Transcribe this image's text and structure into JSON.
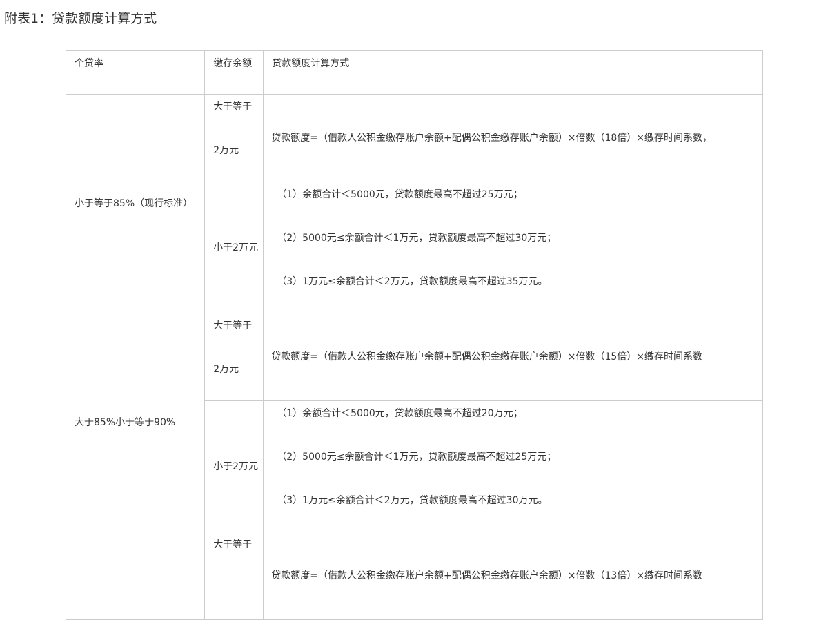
{
  "caption": "附表1：贷款额度计算方式",
  "table": {
    "headers": {
      "rate": "个贷率",
      "balance": "缴存余额",
      "calc": "贷款额度计算方式"
    },
    "groups": [
      {
        "rate": "小于等于85%（现行标准）",
        "high": {
          "balance_line1": "大于等于",
          "balance_line2": "2万元",
          "formula": "贷款额度=（借款人公积金缴存账户余额+配偶公积金缴存账户余额）×倍数（18倍）×缴存时间系数，"
        },
        "low": {
          "balance": "小于2万元",
          "rules": [
            "（1）余额合计＜5000元，贷款额度最高不超过25万元；",
            "（2）5000元≤余额合计＜1万元，贷款额度最高不超过30万元；",
            "（3）1万元≤余额合计＜2万元，贷款额度最高不超过35万元。"
          ]
        }
      },
      {
        "rate": "大于85%小于等于90%",
        "high": {
          "balance_line1": "大于等于",
          "balance_line2": "2万元",
          "formula": "贷款额度=（借款人公积金缴存账户余额+配偶公积金缴存账户余额）×倍数（15倍）×缴存时间系数"
        },
        "low": {
          "balance": "小于2万元",
          "rules": [
            "（1）余额合计＜5000元，贷款额度最高不超过20万元；",
            "（2）5000元≤余额合计＜1万元，贷款额度最高不超过25万元；",
            "（3）1万元≤余额合计＜2万元，贷款额度最高不超过30万元。"
          ]
        }
      },
      {
        "rate": "",
        "high": {
          "balance_line1": "大于等于",
          "balance_line2": "",
          "formula": "贷款额度=（借款人公积金缴存账户余额+配偶公积金缴存账户余额）×倍数（13倍）×缴存时间系数"
        }
      }
    ]
  }
}
